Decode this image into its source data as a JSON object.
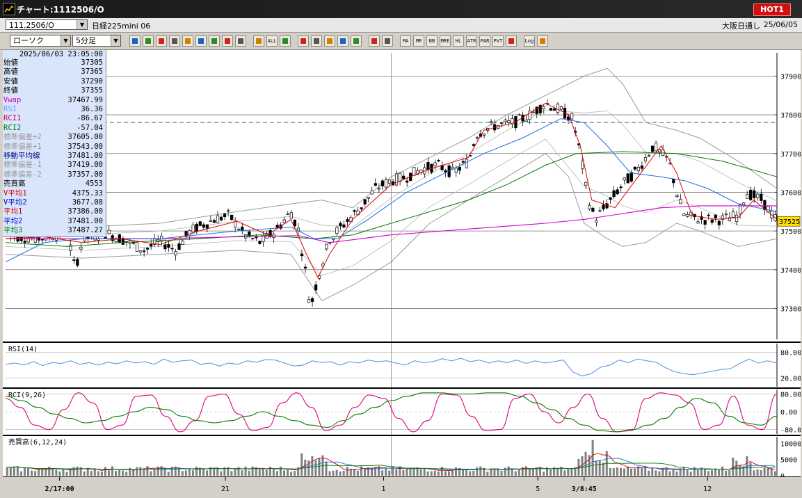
{
  "window": {
    "title": "チャート:1112506/O",
    "hot_label": "HOT1"
  },
  "infobar": {
    "symbol_code": "111.2506/O",
    "symbol_name": "日経225mini 06",
    "market": "大阪日通し",
    "date": "25/06/05"
  },
  "toolbar": {
    "chart_type": "ローソク",
    "interval": "5分足",
    "buttons": [
      "search",
      "list",
      "draw",
      "pen",
      "cursor",
      "undo",
      "sheet",
      "trash",
      "bars1",
      "bars2",
      "ALL",
      "settings",
      "linechart",
      "color",
      "down",
      "zoom",
      "chart1",
      "cross",
      "excl",
      "MA",
      "MR",
      "BB",
      "MRE",
      "HL",
      "ATR",
      "PAR",
      "PVT",
      "box",
      "Log",
      "export"
    ],
    "button_text": {
      "ALL": "ALL",
      "MA": "MA",
      "MR": "MR",
      "BB": "BB",
      "MRE": "MRE",
      "HL": "HL",
      "ATR": "ATR",
      "PAR": "PAR",
      "PVT": "PVT",
      "Log": "Log"
    }
  },
  "info_panel": {
    "datetime": "2025/06/03 23:05:00",
    "rows": [
      {
        "label": "始値",
        "value": "37305",
        "color": "#000000"
      },
      {
        "label": "高値",
        "value": "37365",
        "color": "#000000"
      },
      {
        "label": "安値",
        "value": "37290",
        "color": "#000000"
      },
      {
        "label": "終値",
        "value": "37355",
        "color": "#000000"
      },
      {
        "label": "Vwap",
        "value": "37467.99",
        "color": "#cc00cc"
      },
      {
        "label": "RSI",
        "value": "36.36",
        "color": "#6fa0ff"
      },
      {
        "label": "RCI1",
        "value": "-86.67",
        "color": "#d00060"
      },
      {
        "label": "RCI2",
        "value": "-57.04",
        "color": "#008000"
      },
      {
        "label": "標準偏差+2",
        "value": "37605.00",
        "color": "#9a9a9a"
      },
      {
        "label": "標準偏差+1",
        "value": "37543.00",
        "color": "#9a9a9a"
      },
      {
        "label": "移動平均線",
        "value": "37481.00",
        "color": "#000080"
      },
      {
        "label": "標準偏差-1",
        "value": "37419.00",
        "color": "#9a9a9a"
      },
      {
        "label": "標準偏差-2",
        "value": "37357.00",
        "color": "#9a9a9a"
      },
      {
        "label": "売買高",
        "value": "4553",
        "color": "#000000"
      },
      {
        "label": "V平均1",
        "value": "4375.33",
        "color": "#cc0000"
      },
      {
        "label": "V平均2",
        "value": "3677.08",
        "color": "#0000cc"
      },
      {
        "label": "平均1",
        "value": "37386.00",
        "color": "#cc0000"
      },
      {
        "label": "平均2",
        "value": "37481.00",
        "color": "#0000cc"
      },
      {
        "label": "平均3",
        "value": "37487.27",
        "color": "#008000"
      }
    ]
  },
  "chart_data": [
    {
      "type": "candlestick",
      "ylim": [
        37220,
        37960
      ],
      "y_ticks": [
        37300,
        37400,
        37500,
        37600,
        37700,
        37800,
        37900
      ],
      "y_tick_labels": [
        "37300",
        "37400",
        "37500",
        "37600",
        "37700",
        "37800",
        "37900"
      ],
      "current_price": 37525,
      "current_price_label": "37525",
      "reference_line": 37780,
      "x_tick_labels": [
        {
          "label": "2/17:00",
          "pos": 0.07,
          "bold": true
        },
        {
          "label": "21",
          "pos": 0.285,
          "bold": false
        },
        {
          "label": "1",
          "pos": 0.49,
          "bold": false
        },
        {
          "label": "5",
          "pos": 0.69,
          "bold": false
        },
        {
          "label": "3/8:45",
          "pos": 0.75,
          "bold": true
        },
        {
          "label": "12",
          "pos": 0.91,
          "bold": false
        }
      ],
      "cursor_x": 0.5,
      "candles_close_path": [
        [
          0,
          37490
        ],
        [
          0.04,
          37480
        ],
        [
          0.08,
          37495
        ],
        [
          0.09,
          37400
        ],
        [
          0.1,
          37480
        ],
        [
          0.13,
          37495
        ],
        [
          0.15,
          37480
        ],
        [
          0.18,
          37450
        ],
        [
          0.2,
          37475
        ],
        [
          0.22,
          37450
        ],
        [
          0.24,
          37500
        ],
        [
          0.27,
          37530
        ],
        [
          0.29,
          37540
        ],
        [
          0.31,
          37490
        ],
        [
          0.33,
          37470
        ],
        [
          0.35,
          37500
        ],
        [
          0.37,
          37550
        ],
        [
          0.38,
          37500
        ],
        [
          0.39,
          37380
        ],
        [
          0.395,
          37300
        ],
        [
          0.405,
          37380
        ],
        [
          0.42,
          37480
        ],
        [
          0.44,
          37520
        ],
        [
          0.46,
          37560
        ],
        [
          0.48,
          37610
        ],
        [
          0.5,
          37630
        ],
        [
          0.52,
          37640
        ],
        [
          0.54,
          37660
        ],
        [
          0.56,
          37670
        ],
        [
          0.58,
          37650
        ],
        [
          0.6,
          37680
        ],
        [
          0.61,
          37750
        ],
        [
          0.63,
          37770
        ],
        [
          0.66,
          37780
        ],
        [
          0.68,
          37800
        ],
        [
          0.7,
          37830
        ],
        [
          0.72,
          37810
        ],
        [
          0.735,
          37790
        ],
        [
          0.745,
          37700
        ],
        [
          0.755,
          37580
        ],
        [
          0.765,
          37530
        ],
        [
          0.78,
          37570
        ],
        [
          0.8,
          37620
        ],
        [
          0.82,
          37660
        ],
        [
          0.84,
          37720
        ],
        [
          0.86,
          37680
        ],
        [
          0.87,
          37600
        ],
        [
          0.88,
          37540
        ],
        [
          0.9,
          37530
        ],
        [
          0.93,
          37530
        ],
        [
          0.95,
          37540
        ],
        [
          0.96,
          37600
        ],
        [
          0.98,
          37580
        ],
        [
          1,
          37525
        ]
      ],
      "ma1_path": [
        [
          0,
          37480
        ],
        [
          0.05,
          37485
        ],
        [
          0.1,
          37470
        ],
        [
          0.15,
          37480
        ],
        [
          0.2,
          37465
        ],
        [
          0.25,
          37500
        ],
        [
          0.3,
          37525
        ],
        [
          0.34,
          37490
        ],
        [
          0.37,
          37530
        ],
        [
          0.39,
          37440
        ],
        [
          0.405,
          37380
        ],
        [
          0.42,
          37440
        ],
        [
          0.45,
          37530
        ],
        [
          0.5,
          37620
        ],
        [
          0.55,
          37660
        ],
        [
          0.6,
          37690
        ],
        [
          0.62,
          37760
        ],
        [
          0.66,
          37780
        ],
        [
          0.7,
          37830
        ],
        [
          0.73,
          37800
        ],
        [
          0.745,
          37720
        ],
        [
          0.76,
          37580
        ],
        [
          0.79,
          37560
        ],
        [
          0.82,
          37640
        ],
        [
          0.85,
          37720
        ],
        [
          0.87,
          37650
        ],
        [
          0.89,
          37540
        ],
        [
          0.92,
          37530
        ],
        [
          0.95,
          37535
        ],
        [
          0.97,
          37580
        ],
        [
          1,
          37530
        ]
      ],
      "ma2_path": [
        [
          0,
          37420
        ],
        [
          0.05,
          37470
        ],
        [
          0.1,
          37480
        ],
        [
          0.2,
          37480
        ],
        [
          0.3,
          37500
        ],
        [
          0.37,
          37510
        ],
        [
          0.4,
          37480
        ],
        [
          0.43,
          37480
        ],
        [
          0.47,
          37530
        ],
        [
          0.52,
          37600
        ],
        [
          0.57,
          37650
        ],
        [
          0.62,
          37700
        ],
        [
          0.67,
          37740
        ],
        [
          0.72,
          37790
        ],
        [
          0.75,
          37780
        ],
        [
          0.78,
          37720
        ],
        [
          0.81,
          37650
        ],
        [
          0.85,
          37640
        ],
        [
          0.88,
          37630
        ],
        [
          0.91,
          37610
        ],
        [
          0.95,
          37570
        ],
        [
          1,
          37550
        ]
      ],
      "ma3_path": [
        [
          0,
          37470
        ],
        [
          0.08,
          37460
        ],
        [
          0.15,
          37470
        ],
        [
          0.25,
          37480
        ],
        [
          0.33,
          37490
        ],
        [
          0.4,
          37480
        ],
        [
          0.45,
          37490
        ],
        [
          0.5,
          37520
        ],
        [
          0.55,
          37550
        ],
        [
          0.6,
          37580
        ],
        [
          0.65,
          37620
        ],
        [
          0.7,
          37670
        ],
        [
          0.74,
          37700
        ],
        [
          0.8,
          37705
        ],
        [
          0.87,
          37700
        ],
        [
          0.93,
          37680
        ],
        [
          1,
          37640
        ]
      ],
      "vwap_path": [
        [
          0,
          37480
        ],
        [
          0.1,
          37480
        ],
        [
          0.2,
          37480
        ],
        [
          0.3,
          37485
        ],
        [
          0.38,
          37488
        ],
        [
          0.42,
          37470
        ],
        [
          0.5,
          37490
        ],
        [
          0.6,
          37505
        ],
        [
          0.7,
          37520
        ],
        [
          0.75,
          37530
        ],
        [
          0.8,
          37545
        ],
        [
          0.85,
          37560
        ],
        [
          0.9,
          37565
        ],
        [
          1,
          37565
        ]
      ],
      "bb_upper_path": [
        [
          0,
          37520
        ],
        [
          0.1,
          37510
        ],
        [
          0.2,
          37520
        ],
        [
          0.3,
          37550
        ],
        [
          0.37,
          37570
        ],
        [
          0.41,
          37580
        ],
        [
          0.45,
          37560
        ],
        [
          0.5,
          37640
        ],
        [
          0.55,
          37690
        ],
        [
          0.6,
          37740
        ],
        [
          0.65,
          37800
        ],
        [
          0.7,
          37850
        ],
        [
          0.75,
          37900
        ],
        [
          0.78,
          37920
        ],
        [
          0.8,
          37880
        ],
        [
          0.83,
          37780
        ],
        [
          0.87,
          37760
        ],
        [
          0.9,
          37740
        ],
        [
          0.95,
          37680
        ],
        [
          1,
          37610
        ]
      ],
      "bb_lower_path": [
        [
          0,
          37440
        ],
        [
          0.1,
          37430
        ],
        [
          0.2,
          37440
        ],
        [
          0.3,
          37450
        ],
        [
          0.37,
          37440
        ],
        [
          0.41,
          37320
        ],
        [
          0.45,
          37360
        ],
        [
          0.5,
          37420
        ],
        [
          0.55,
          37520
        ],
        [
          0.6,
          37580
        ],
        [
          0.65,
          37640
        ],
        [
          0.7,
          37700
        ],
        [
          0.73,
          37640
        ],
        [
          0.75,
          37520
        ],
        [
          0.78,
          37480
        ],
        [
          0.8,
          37460
        ],
        [
          0.83,
          37470
        ],
        [
          0.87,
          37520
        ],
        [
          0.9,
          37500
        ],
        [
          0.95,
          37460
        ],
        [
          1,
          37480
        ]
      ]
    },
    {
      "type": "line",
      "title": "RSI(14)",
      "ylim": [
        0,
        100
      ],
      "y_tick_labels": [
        "80.00",
        "20.00"
      ],
      "values": [
        52,
        55,
        50,
        58,
        49,
        56,
        54,
        60,
        52,
        56,
        50,
        57,
        53,
        60,
        55,
        58,
        52,
        64,
        57,
        60,
        62,
        52,
        55,
        48,
        55,
        52,
        60,
        57,
        63,
        62,
        55,
        48,
        50,
        60,
        56,
        58,
        50,
        58,
        55,
        62,
        58,
        60,
        55,
        50,
        60,
        56,
        58,
        65,
        60,
        66,
        58,
        62,
        55,
        60,
        56,
        62,
        54,
        60,
        55,
        58,
        62,
        35,
        25,
        30,
        45,
        50,
        62,
        56,
        64,
        60,
        57,
        44,
        35,
        30,
        28,
        32,
        36,
        40,
        42,
        54,
        64,
        55,
        60,
        55
      ]
    },
    {
      "type": "line",
      "title": "RCI(9,26)",
      "ylim": [
        -100,
        100
      ],
      "y_tick_labels": [
        "80.00",
        "0.00",
        "-80.00"
      ],
      "series": [
        {
          "values": [
            60,
            20,
            -60,
            -80,
            10,
            85,
            40,
            -80,
            -60,
            70,
            75,
            -20,
            -90,
            -40,
            70,
            80,
            -10,
            -85,
            -70,
            40,
            85,
            20,
            -85,
            -60,
            20,
            75,
            60,
            -30,
            -90,
            -40,
            80,
            75,
            -20,
            -85,
            -80,
            60,
            80,
            0,
            -50,
            20,
            80,
            -30,
            -90,
            -85,
            60,
            85,
            75,
            40,
            -80,
            -60,
            70,
            -60,
            -80,
            80
          ]
        },
        {
          "values": [
            70,
            50,
            20,
            -10,
            -30,
            -50,
            -40,
            -20,
            0,
            20,
            10,
            -20,
            -40,
            -50,
            -40,
            -20,
            0,
            -20,
            -40,
            -60,
            -70,
            -40,
            -10,
            20,
            50,
            70,
            85,
            85,
            80,
            80,
            85,
            85,
            70,
            40,
            10,
            -30,
            -60,
            -85,
            -90,
            -80,
            -60,
            -30,
            20,
            60,
            40,
            -20,
            -50,
            -60,
            -20
          ]
        }
      ]
    },
    {
      "type": "bar",
      "title": "売買高(6,12,24)",
      "ylim": [
        0,
        12000
      ],
      "y_tick_labels": [
        "10000",
        "5000",
        "0"
      ]
    }
  ]
}
